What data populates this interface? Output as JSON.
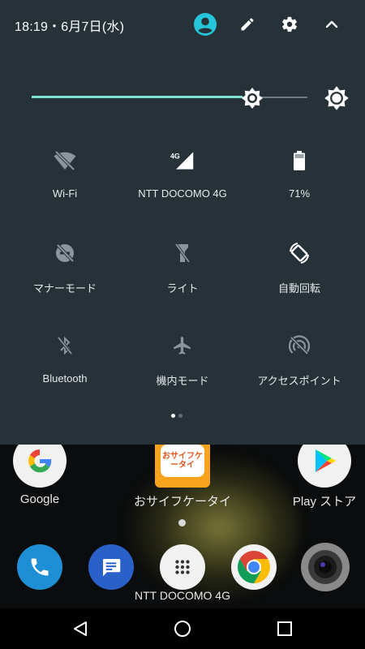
{
  "status_bar": {
    "datetime": "18:19・6月7日(水)"
  },
  "brightness": {
    "level": 0.8
  },
  "tiles": [
    {
      "label": "Wi-Fi",
      "icon": "wifi-off-icon",
      "active": false
    },
    {
      "label": "NTT DOCOMO 4G",
      "icon": "signal-4g-icon",
      "active": true
    },
    {
      "label": "71%",
      "icon": "battery-icon",
      "active": true
    },
    {
      "label": "マナーモード",
      "icon": "do-not-disturb-off-icon",
      "active": false
    },
    {
      "label": "ライト",
      "icon": "flashlight-off-icon",
      "active": false
    },
    {
      "label": "自動回転",
      "icon": "auto-rotate-icon",
      "active": true
    },
    {
      "label": "Bluetooth",
      "icon": "bluetooth-off-icon",
      "active": false
    },
    {
      "label": "機内モード",
      "icon": "airplane-icon",
      "active": false
    },
    {
      "label": "アクセスポイント",
      "icon": "hotspot-off-icon",
      "active": false
    }
  ],
  "pager": {
    "pages": 2,
    "current": 1
  },
  "home": {
    "apps": [
      {
        "label": "Google"
      },
      {
        "label": "おサイフケータイ",
        "icon_text": "おサイフケータイ"
      },
      {
        "label": "Play ストア"
      }
    ],
    "carrier": "NTT DOCOMO 4G"
  },
  "colors": {
    "panel": "#263238",
    "accent": "#7fe0d4",
    "profile": "#26c6da",
    "inactive_icon": "#8a969b"
  }
}
